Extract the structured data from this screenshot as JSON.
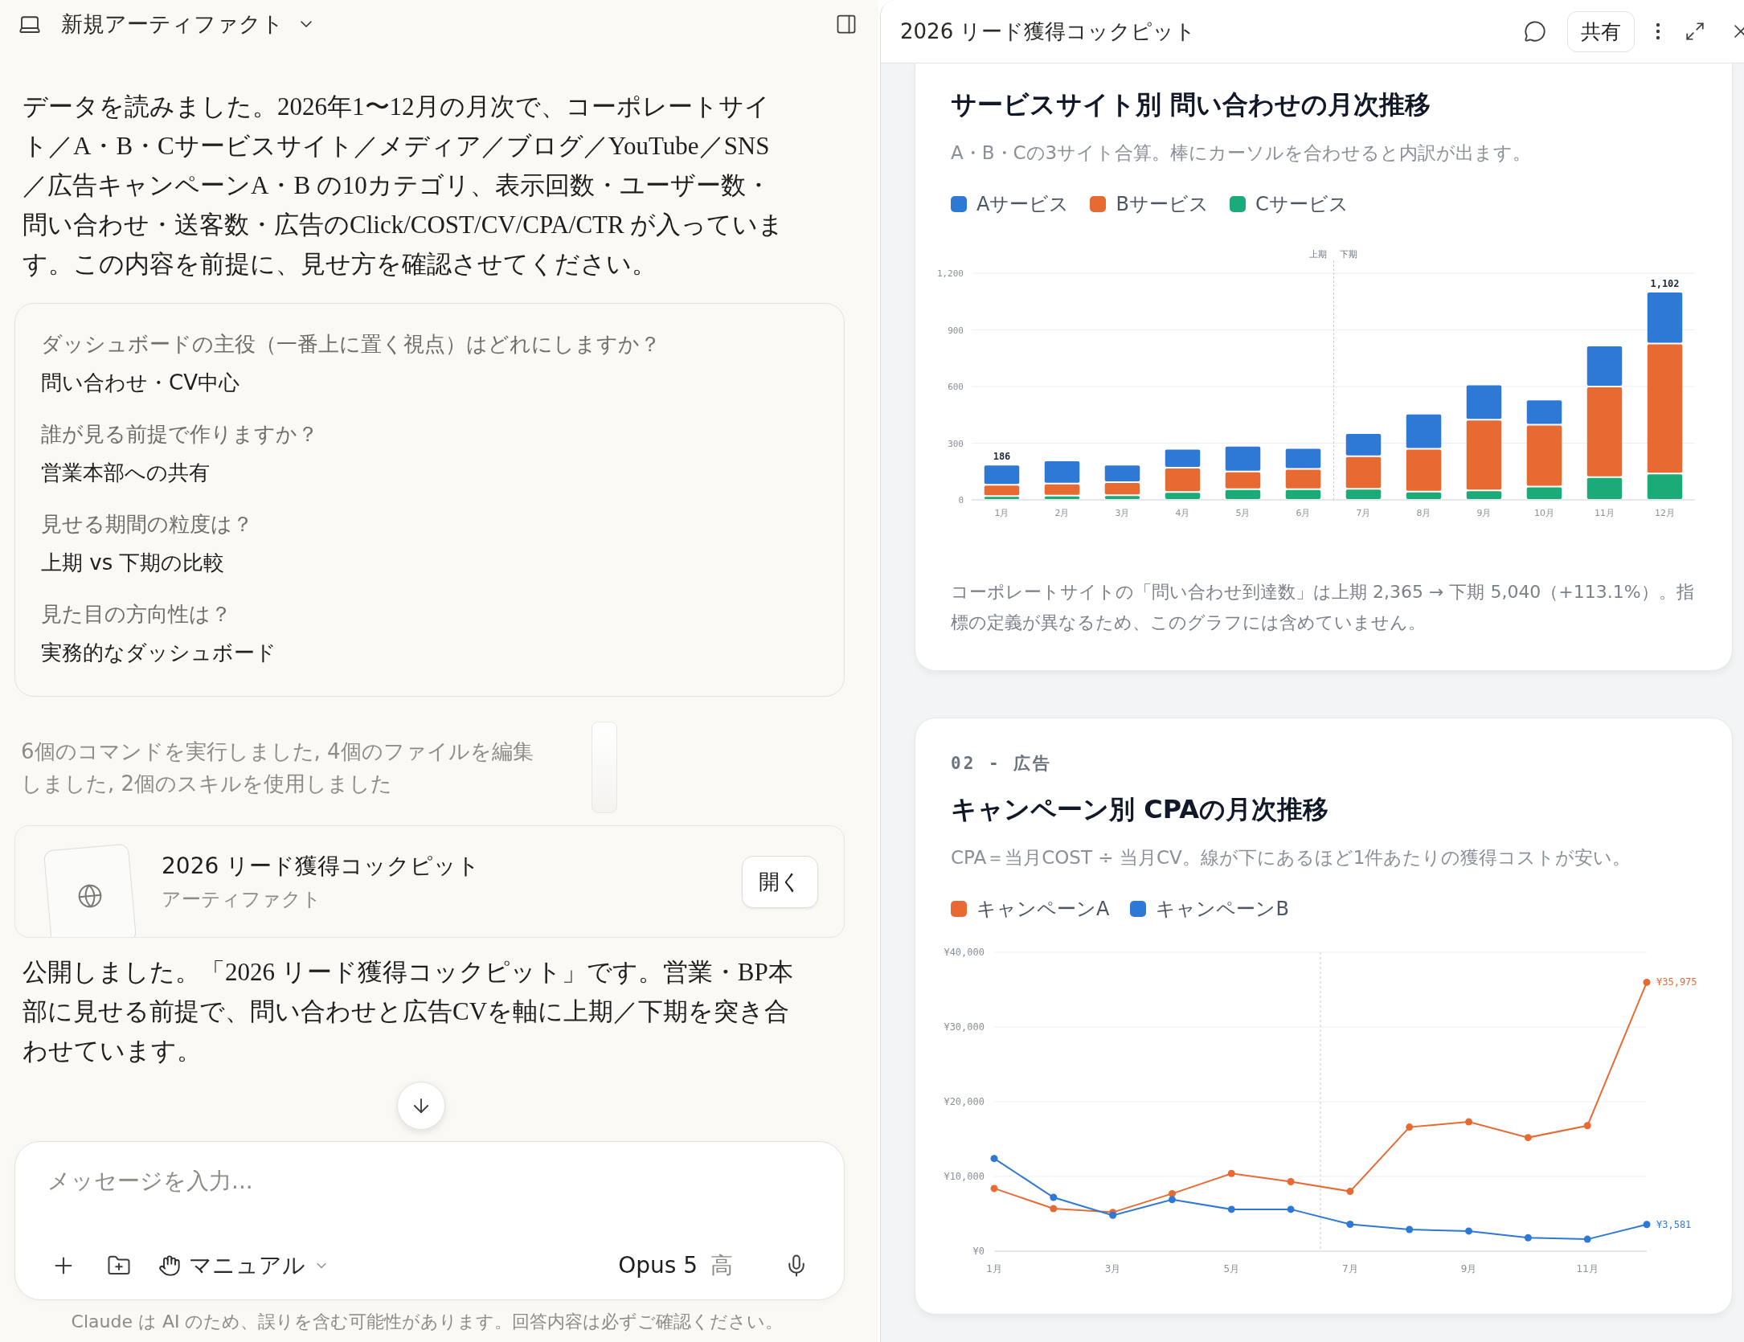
{
  "chat": {
    "title": "新規アーティファクト",
    "intro": "データを読みました。2026年1〜12月の月次で、コーポレートサイト／A・B・Cサービスサイト／メディア／ブログ／YouTube／SNS／広告キャンペーンA・B の10カテゴリ、表示回数・ユーザー数・問い合わせ・送客数・広告のClick/COST/CV/CPA/CTR が入っています。この内容を前提に、見せ方を確認させてください。",
    "answers": [
      {
        "question": "ダッシュボードの主役（一番上に置く視点）はどれにしますか？",
        "answer": "問い合わせ・CV中心"
      },
      {
        "question": "誰が見る前提で作りますか？",
        "answer": "営業本部への共有"
      },
      {
        "question": "見せる期間の粒度は？",
        "answer": "上期 vs 下期の比較"
      },
      {
        "question": "見た目の方向性は？",
        "answer": "実務的なダッシュボード"
      }
    ],
    "activity": "6個のコマンドを実行しました, 4個のファイルを編集しました, 2個のスキルを使用しました",
    "artifact": {
      "title": "2026 リード獲得コックピット",
      "type": "アーティファクト",
      "button": "開く"
    },
    "reply": "公開しました。「2026 リード獲得コックピット」です。営業・BP本部に見せる前提で、問い合わせと広告CVを軸に上期／下期を突き合わせています。",
    "composer": {
      "placeholder": "メッセージを入力...",
      "mode": "マニュアル",
      "model": "Opus 5",
      "effort": "高"
    },
    "disclaimer": "Claude は AI のため、誤りを含む可能性があります。回答内容は必ずご確認ください。"
  },
  "artifact_panel": {
    "title": "2026 リード獲得コックピット",
    "share_button": "共有",
    "cards": [
      {
        "title": "サービスサイト別 問い合わせの月次推移",
        "subtitle": "A・B・Cの3サイト合算。棒にカーソルを合わせると内訳が出ます。",
        "chart_data": {
          "type": "bar",
          "stacked": true,
          "grid": true,
          "categories": [
            "1月",
            "2月",
            "3月",
            "4月",
            "5月",
            "6月",
            "7月",
            "8月",
            "9月",
            "10月",
            "11月",
            "12月"
          ],
          "series": [
            {
              "name": "Aサービス",
              "color": "#2e78d6",
              "values": [
                106,
                122,
                92,
                100,
                136,
                111,
                122,
                186,
                186,
                133,
                217,
                274
              ]
            },
            {
              "name": "Bサービス",
              "color": "#e86a33",
              "values": [
                60,
                64,
                69,
                128,
                94,
                108,
                173,
                226,
                375,
                328,
                480,
                689
              ]
            },
            {
              "name": "Cサービス",
              "color": "#1bab78",
              "values": [
                20,
                22,
                25,
                42,
                56,
                56,
                58,
                44,
                50,
                70,
                120,
                139
              ]
            }
          ],
          "ylim": [
            0,
            1200
          ],
          "yticks": [
            {
              "value": 0,
              "label": "0"
            },
            {
              "value": 300,
              "label": "300"
            },
            {
              "value": 600,
              "label": "600"
            },
            {
              "value": 900,
              "label": "900"
            },
            {
              "value": 1200,
              "label": "1,200"
            }
          ],
          "annotations": [
            {
              "x": "1月",
              "y": 186,
              "text": "186"
            },
            {
              "x": "12月",
              "y": 1102,
              "text": "1,102"
            },
            "上期",
            "下期"
          ]
        },
        "note": "コーポレートサイトの「問い合わせ到達数」は上期 2,365 → 下期 5,040（+113.1%）。指標の定義が異なるため、このグラフには含めていません。"
      },
      {
        "section": "02 - 広告",
        "title": "キャンペーン別 CPAの月次推移",
        "subtitle": "CPA＝当月COST ÷ 当月CV。線が下にあるほど1件あたりの獲得コストが安い。",
        "chart_data": {
          "type": "line",
          "grid": true,
          "x": [
            1,
            2,
            3,
            4,
            5,
            6,
            7,
            8,
            9,
            10,
            11,
            12
          ],
          "series": [
            {
              "name": "キャンペーンA",
              "color": "#e86a33",
              "marker": "o",
              "values": [
                8400,
                5700,
                5200,
                7700,
                10400,
                9300,
                8000,
                16600,
                17300,
                15200,
                16800,
                35975
              ]
            },
            {
              "name": "キャンペーンB",
              "color": "#2e78d6",
              "marker": "o",
              "values": [
                12400,
                7200,
                4800,
                6900,
                5600,
                5600,
                3600,
                2900,
                2700,
                1800,
                1600,
                3581
              ]
            }
          ],
          "xlim": [
            1,
            12
          ],
          "ylim": [
            0,
            40000
          ],
          "xticks": [
            {
              "value": 1,
              "label": "1月"
            },
            {
              "value": 3,
              "label": "3月"
            },
            {
              "value": 5,
              "label": "5月"
            },
            {
              "value": 7,
              "label": "7月"
            },
            {
              "value": 9,
              "label": "9月"
            },
            {
              "value": 11,
              "label": "11月"
            }
          ],
          "yticks": [
            {
              "value": 0,
              "label": "¥0"
            },
            {
              "value": 10000,
              "label": "¥10,000"
            },
            {
              "value": 20000,
              "label": "¥20,000"
            },
            {
              "value": 30000,
              "label": "¥30,000"
            },
            {
              "value": 40000,
              "label": "¥40,000"
            }
          ],
          "ref_lines": [
            {
              "axis": "x",
              "value": 6.5
            }
          ],
          "annotations": [
            {
              "x": 12,
              "y": 35975,
              "text": "¥35,975"
            },
            {
              "x": 12,
              "y": 3581,
              "text": "¥3,581"
            }
          ]
        }
      }
    ]
  }
}
